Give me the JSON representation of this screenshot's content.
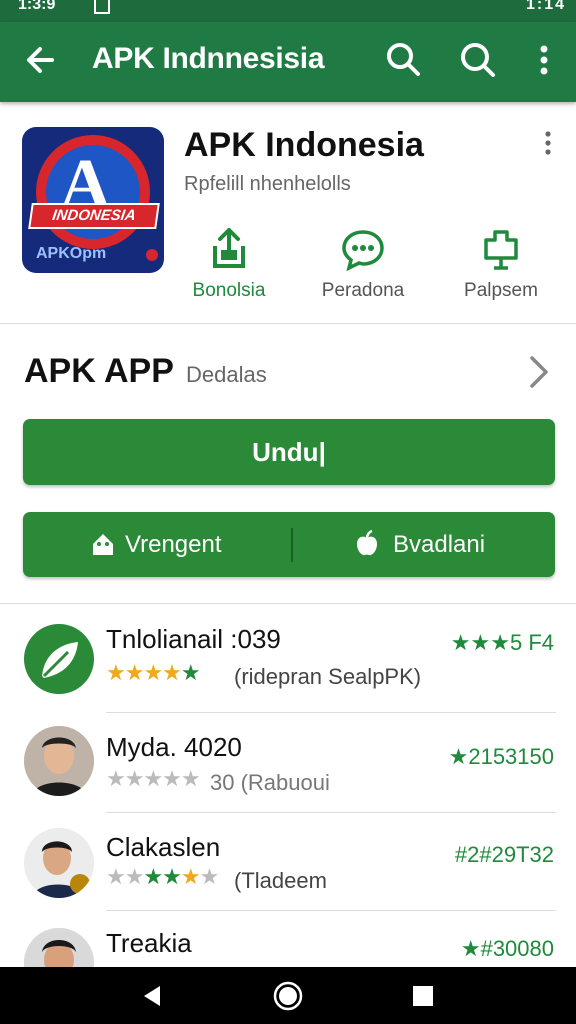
{
  "status_bar": {
    "time": "1:3:9",
    "right": "1:14"
  },
  "app_bar": {
    "title": "APK Indnnesisia"
  },
  "app": {
    "name": "APK Indonesia",
    "subtitle": "Rpfelill nhenhelolls",
    "icon_ribbon": "INDONESIA",
    "icon_sub": "APKOpm",
    "icon_letter": "A"
  },
  "actions": [
    {
      "label": "Bonolsia",
      "icon": "share-icon"
    },
    {
      "label": "Peradona",
      "icon": "chat-icon"
    },
    {
      "label": "Palpsem",
      "icon": "tv-icon"
    }
  ],
  "details": {
    "title": "APK APP",
    "subtitle": "Dedalas"
  },
  "buttons": {
    "download": "Undu|",
    "left": "Vrengent",
    "right": "Bvadlani"
  },
  "list": [
    {
      "name": "Tnlolianail :039",
      "meta": "(ridepran SealpPK)",
      "score": "★★★5 F4",
      "rating": 4.5,
      "avatar": "app-logo"
    },
    {
      "name": "Myda. 4020",
      "meta": "30 (Rabuoui",
      "score": "★2153150",
      "rating": 0,
      "avatar": "person"
    },
    {
      "name": "Clakaslen",
      "meta": "(Tladeem",
      "score": "#2#29T32",
      "rating": 4,
      "avatar": "person"
    },
    {
      "name": "Treakia",
      "meta": "",
      "score": "★#30080",
      "rating": 0,
      "avatar": "person"
    }
  ],
  "colors": {
    "app_bar": "#1f7a44",
    "status_bar": "#1e6b3e",
    "accent_green": "#2b8a37",
    "star_gold": "#f0a81c"
  }
}
